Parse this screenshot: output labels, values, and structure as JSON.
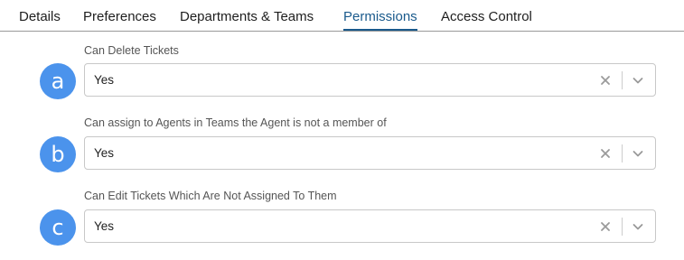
{
  "tabs": [
    {
      "label": "Details",
      "active": false
    },
    {
      "label": "Preferences",
      "active": false
    },
    {
      "label": "Departments & Teams",
      "active": false
    },
    {
      "label": "Permissions",
      "active": true
    },
    {
      "label": "Access Control",
      "active": false
    }
  ],
  "fields": [
    {
      "badge": "a",
      "label": "Can Delete Tickets",
      "value": "Yes"
    },
    {
      "badge": "b",
      "label": "Can assign to Agents in Teams the Agent is not a member of",
      "value": "Yes"
    },
    {
      "badge": "c",
      "label": "Can Edit Tickets Which Are Not Assigned To Them",
      "value": "Yes"
    }
  ],
  "colors": {
    "accent": "#1a5a8c",
    "badge": "#4b93ec"
  }
}
